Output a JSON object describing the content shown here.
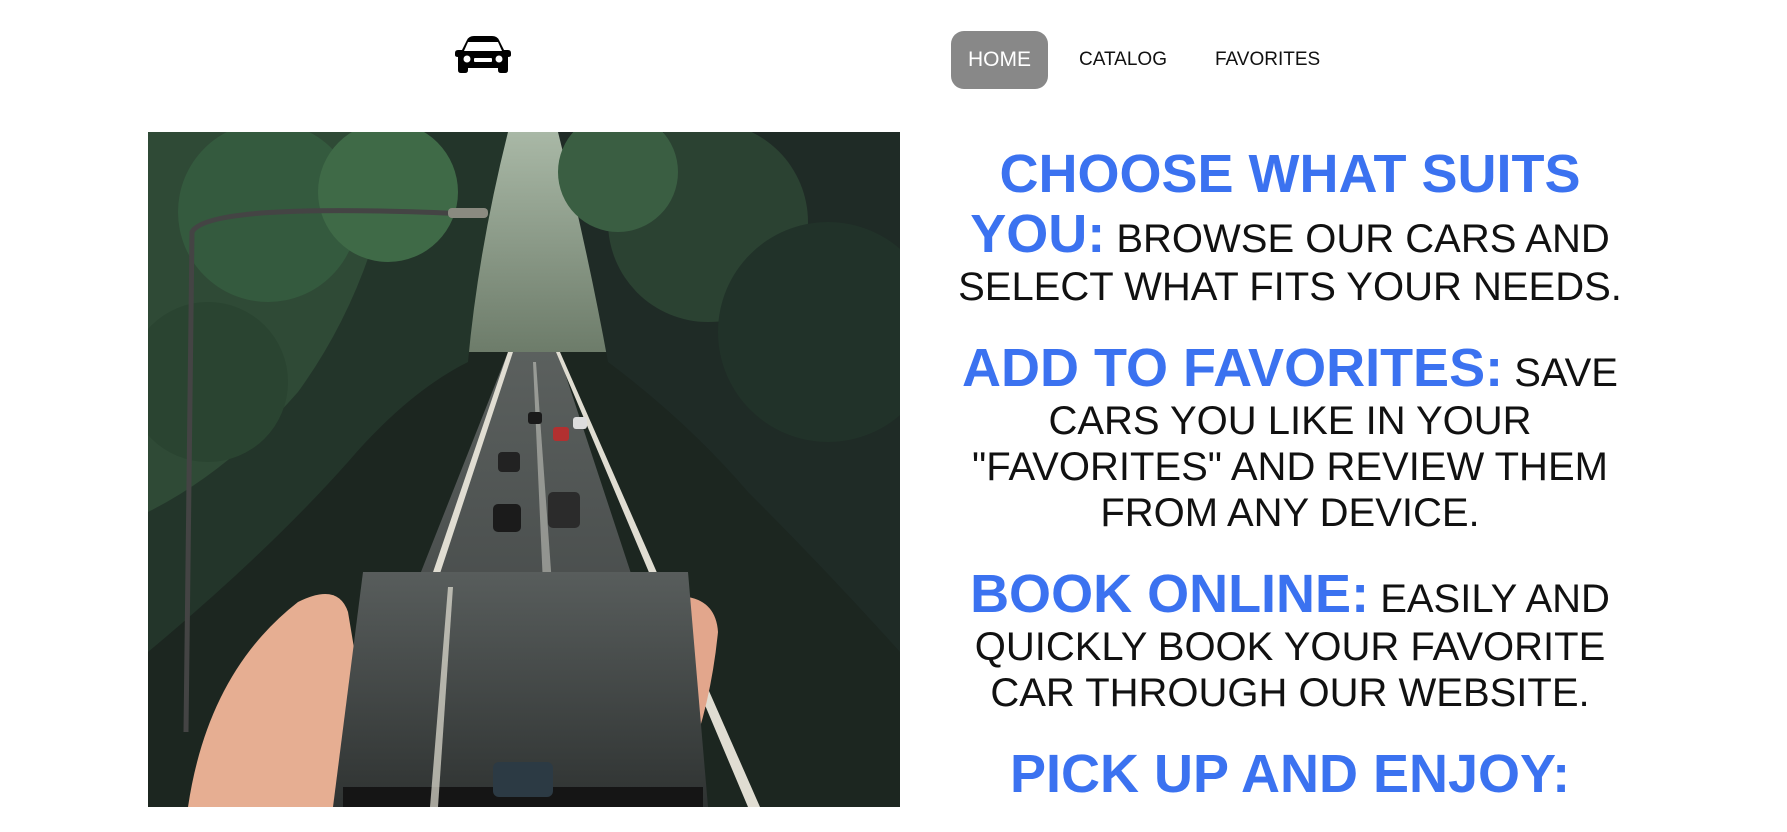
{
  "header": {
    "logo_icon": "car-icon",
    "nav": [
      {
        "label": "HOME",
        "active": true
      },
      {
        "label": "CATALOG",
        "active": false
      },
      {
        "label": "FAVORITES",
        "active": false
      }
    ]
  },
  "hero": {
    "image": "road-through-forest-in-phone-photo"
  },
  "features": [
    {
      "title": "CHOOSE WHAT SUITS YOU:",
      "text": "BROWSE OUR CARS AND SELECT WHAT FITS YOUR NEEDS."
    },
    {
      "title": "ADD TO FAVORITES:",
      "text": "SAVE CARS YOU LIKE IN YOUR \"FAVORITES\" AND REVIEW THEM FROM ANY DEVICE."
    },
    {
      "title": "BOOK ONLINE:",
      "text": "EASILY AND QUICKLY BOOK YOUR FAVORITE CAR THROUGH OUR WEBSITE."
    },
    {
      "title": "PICK UP AND ENJOY:",
      "text": ""
    }
  ],
  "colors": {
    "accent": "#3b72f0",
    "nav_active_bg": "#888888",
    "text": "#111111"
  }
}
